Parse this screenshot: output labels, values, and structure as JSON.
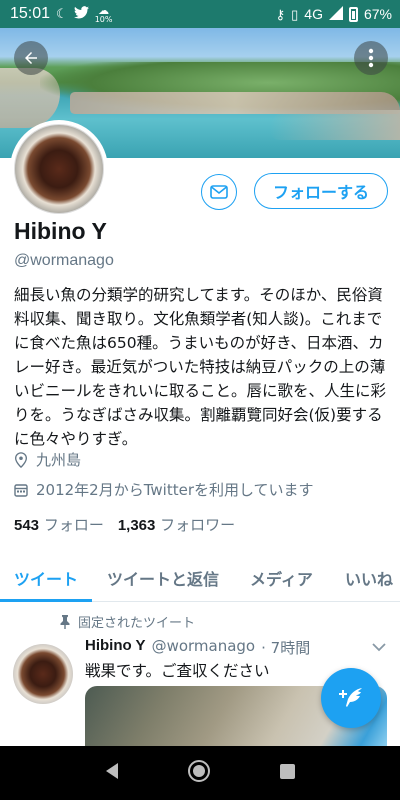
{
  "status_bar": {
    "time": "15:01",
    "weather_badge": "10%",
    "network": "4G",
    "battery": "67%"
  },
  "profile": {
    "name": "Hibino Y",
    "handle": "@wormanago",
    "follow_label": "フォローする",
    "bio": "細長い魚の分類学的研究してます。そのほか、民俗資料収集、聞き取り。文化魚類学者(知人談)。これまでに食べた魚は650種。うまいものが好き、日本酒、カレー好き。最近気がついた特技は納豆パックの上の薄いビニールをきれいに取ること。唇に歌を、人生に彩りを。うなぎばさみ収集。割離覇覽同好会(仮)要するに色々やりすぎ。",
    "location": "九州島",
    "joined": "2012年2月からTwitterを利用しています",
    "following_count": "543",
    "following_label": "フォロー",
    "followers_count": "1,363",
    "followers_label": "フォロワー"
  },
  "tabs": [
    {
      "label": "ツイート",
      "active": true
    },
    {
      "label": "ツイートと返信",
      "active": false
    },
    {
      "label": "メディア",
      "active": false
    },
    {
      "label": "いいね",
      "active": false
    }
  ],
  "pinned_tweet": {
    "pinned_label": "固定されたツイート",
    "author_name": "Hibino Y",
    "author_handle": "@wormanago",
    "time": "· 7時間",
    "text": "戦果です。ご査収ください"
  },
  "colors": {
    "accent": "#1da1f2",
    "status_bar": "#1d7a6d",
    "muted_text": "#657786"
  },
  "icons": {
    "back": "arrow-left-icon",
    "more": "more-vertical-icon",
    "message": "envelope-icon",
    "location": "location-pin-icon",
    "calendar": "calendar-icon",
    "pin": "pin-icon",
    "compose": "compose-feather-icon"
  }
}
